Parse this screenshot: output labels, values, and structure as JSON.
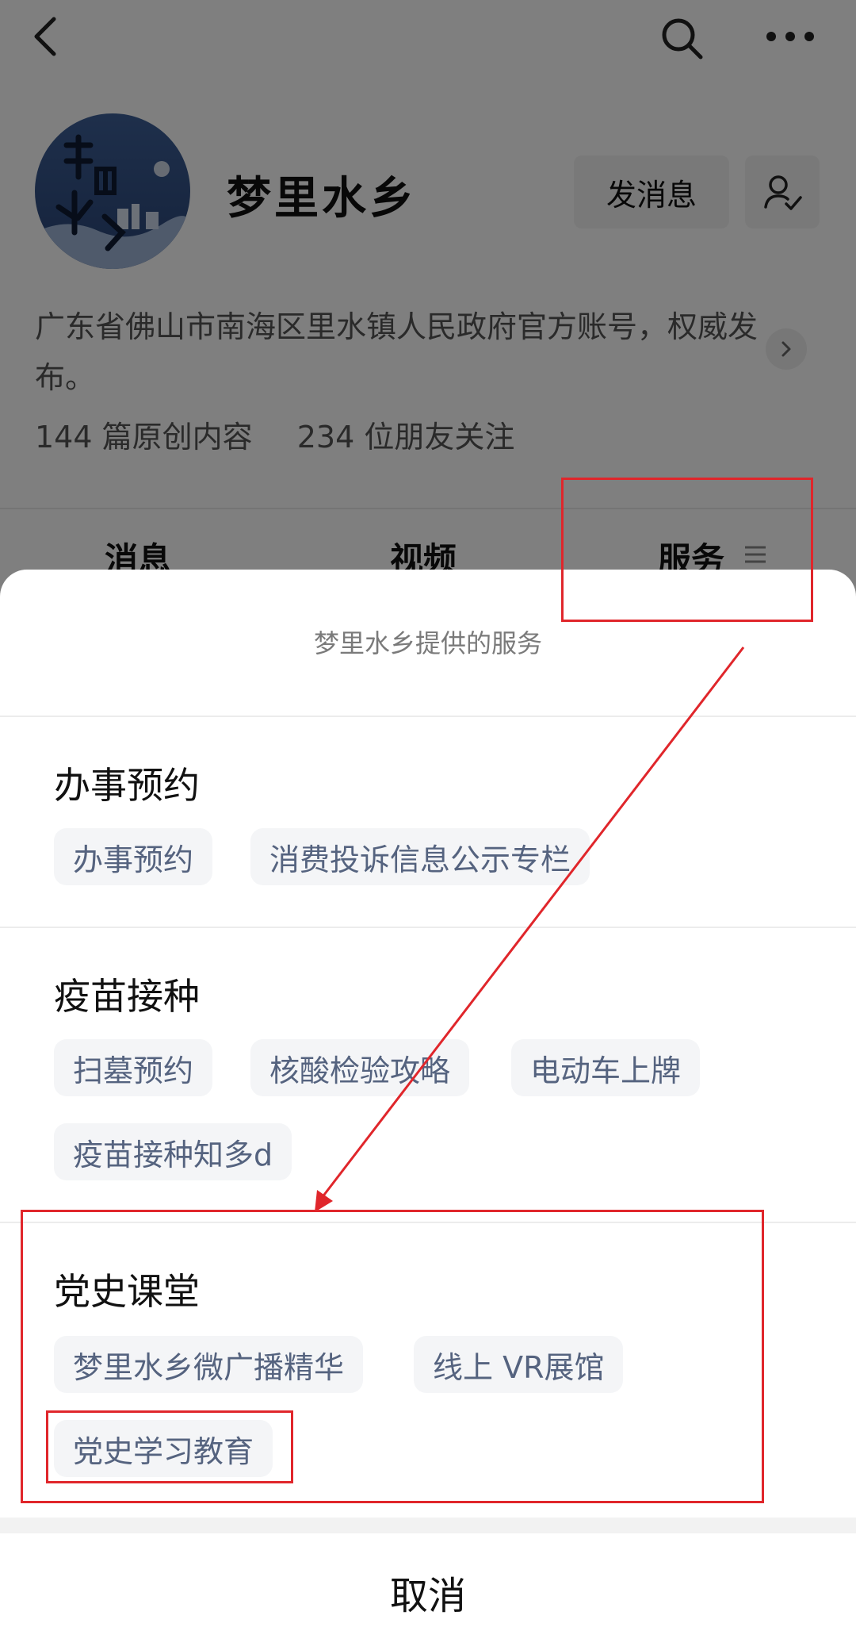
{
  "profile": {
    "name": "梦里水乡",
    "avatar_text": "梦里水乡",
    "message_button": "发消息",
    "description": "广东省佛山市南海区里水镇人民政府官方账号，权威发布。",
    "stats": {
      "articles": "144 篇原创内容",
      "followers": "234 位朋友关注"
    }
  },
  "tabs": [
    {
      "label": "消息"
    },
    {
      "label": "视频"
    },
    {
      "label": "服务"
    }
  ],
  "sheet": {
    "title": "梦里水乡提供的服务",
    "sections": [
      {
        "title": "办事预约",
        "chips": [
          "办事预约",
          "消费投诉信息公示专栏"
        ]
      },
      {
        "title": "疫苗接种",
        "chips": [
          "扫墓预约",
          "核酸检验攻略",
          "电动车上牌",
          "疫苗接种知多d"
        ]
      },
      {
        "title": "党史课堂",
        "chips": [
          "梦里水乡微广播精华",
          "线上 VR展馆",
          "党史学习教育"
        ]
      }
    ],
    "cancel": "取消"
  },
  "icons": {
    "back": "back-arrow-icon",
    "search": "search-icon",
    "more": "more-dots-icon",
    "follow": "user-check-icon",
    "chevron": "chevron-right-icon",
    "tab_menu": "menu-lines-icon"
  },
  "colors": {
    "annotation": "#e0262b",
    "chip_text": "#55637f",
    "chip_bg": "#f4f5f7"
  }
}
